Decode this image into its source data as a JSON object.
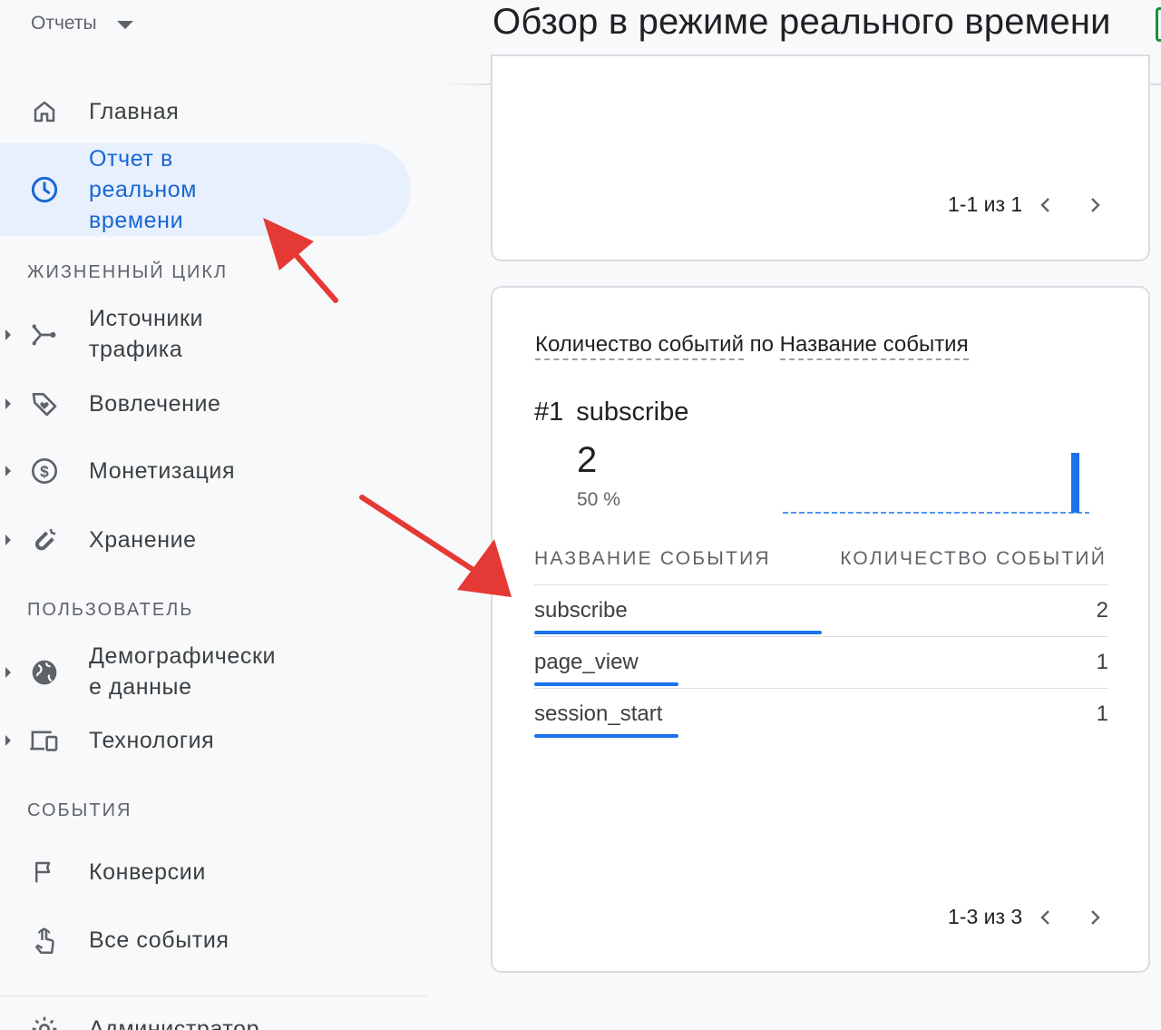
{
  "header": {
    "reports_label": "Отчеты",
    "page_title": "Обзор в режиме реального времени"
  },
  "sidebar": {
    "home": "Главная",
    "realtime": "Отчет в\nреальном\nвремени",
    "section_lifecycle": "ЖИЗНЕННЫЙ ЦИКЛ",
    "traffic": "Источники\nтрафика",
    "engagement": "Вовлечение",
    "monetization": "Монетизация",
    "retention": "Хранение",
    "section_user": "ПОЛЬЗОВАТЕЛЬ",
    "demographics": "Демографически\nе данные",
    "technology": "Технология",
    "section_events": "СОБЫТИЯ",
    "conversions": "Конверсии",
    "all_events": "Все события",
    "admin": "Администратор"
  },
  "card1": {
    "pager": "1-1 из 1"
  },
  "card2": {
    "title_metric": "Количество событий",
    "title_by": "по",
    "title_dimension": "Название события",
    "top_rank": "#1",
    "top_event": "subscribe",
    "top_value": "2",
    "top_percent": "50 %",
    "col_name": "НАЗВАНИЕ СОБЫТИЯ",
    "col_count": "КОЛИЧЕСТВО СОБЫТИЙ",
    "rows": [
      {
        "name": "subscribe",
        "value": "2",
        "share": 1.0
      },
      {
        "name": "page_view",
        "value": "1",
        "share": 0.5
      },
      {
        "name": "session_start",
        "value": "1",
        "share": 0.5
      }
    ],
    "pager": "1-3 из 3"
  },
  "colors": {
    "accent": "#1a73e8",
    "active_bg": "#e8f0fe",
    "active_text": "#1967d2",
    "annotation_arrow": "#e53935"
  }
}
